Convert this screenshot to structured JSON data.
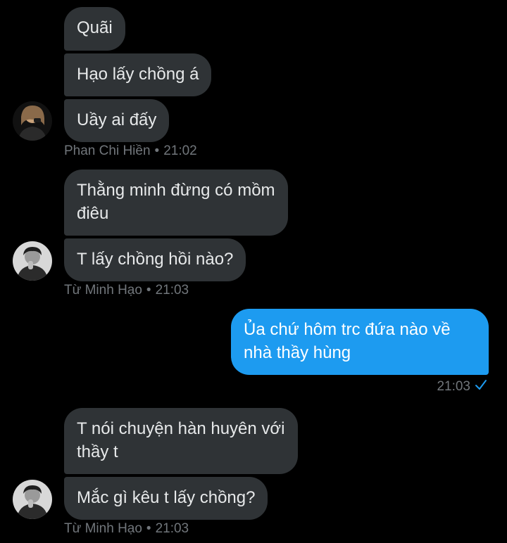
{
  "messages": {
    "g1": {
      "bubbles": [
        "Quãi",
        "Hạo lấy chồng á",
        "Uầy ai đấy"
      ],
      "sender": "Phan Chi Hiền",
      "time": "21:02"
    },
    "g2": {
      "bubbles": [
        "Thằng minh đừng có mồm\nđiêu",
        "T lấy chồng hồi nào?"
      ],
      "sender": "Từ Minh Hạo",
      "time": "21:03"
    },
    "sent": {
      "text": "Ủa chứ hôm trc đứa nào về\nnhà thầy hùng",
      "time": "21:03"
    },
    "g3": {
      "bubbles": [
        "T nói chuyện hàn huyên với\nthầy t",
        "Mắc gì kêu t lấy chồng?"
      ],
      "sender": "Từ Minh Hạo",
      "time": "21:03"
    },
    "separator": "•"
  },
  "colors": {
    "background": "#000000",
    "received_bubble": "#2f3336",
    "sent_bubble": "#1d9bf0",
    "meta_text": "#71767b",
    "read_check": "#1d9bf0"
  },
  "icons": {
    "avatar_1": "avatar-photo-woman",
    "avatar_2": "avatar-photo-man",
    "read_receipt": "checkmark-icon"
  }
}
